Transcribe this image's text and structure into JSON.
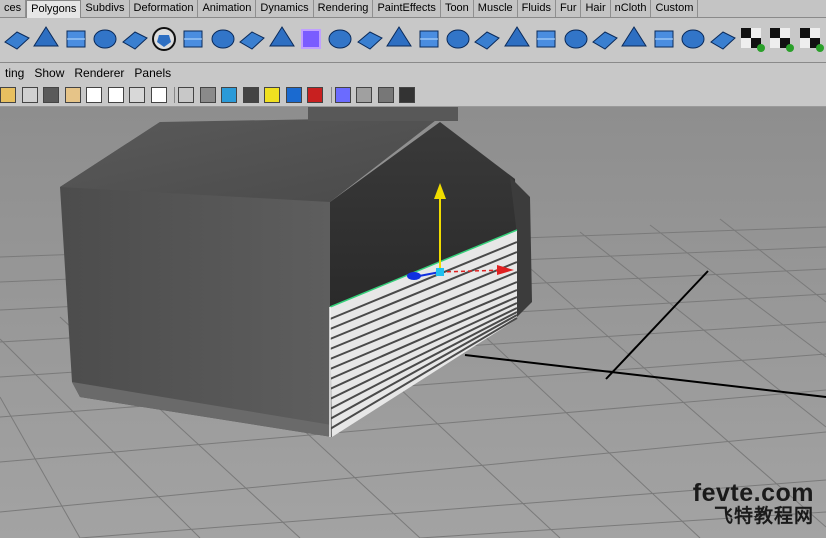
{
  "shelf_tabs": [
    {
      "label": "ces",
      "active": false
    },
    {
      "label": "Polygons",
      "active": true
    },
    {
      "label": "Subdivs",
      "active": false
    },
    {
      "label": "Deformation",
      "active": false
    },
    {
      "label": "Animation",
      "active": false
    },
    {
      "label": "Dynamics",
      "active": false
    },
    {
      "label": "Rendering",
      "active": false
    },
    {
      "label": "PaintEffects",
      "active": false
    },
    {
      "label": "Toon",
      "active": false
    },
    {
      "label": "Muscle",
      "active": false
    },
    {
      "label": "Fluids",
      "active": false
    },
    {
      "label": "Fur",
      "active": false
    },
    {
      "label": "Hair",
      "active": false
    },
    {
      "label": "nCloth",
      "active": false
    },
    {
      "label": "Custom",
      "active": false
    }
  ],
  "shelf_icons": [
    "poly-cylinder-partial-icon",
    "poly-plane-icon",
    "poly-torus-icon",
    "poly-pyramid-icon",
    "poly-cylinder-icon",
    "poly-soccerball-icon",
    "combine-icon",
    "separate-icon",
    "mirror-geometry-icon",
    "boolean-union-icon",
    "smooth-proxy-icon",
    "extrude-face-icon",
    "split-polygon-icon",
    "bevel-icon",
    "append-polygon-icon",
    "fill-hole-icon",
    "merge-vertices-icon",
    "slide-edge-icon",
    "insert-edge-loop-icon",
    "wedge-icon",
    "poke-face-icon",
    "triangulate-icon",
    "quadrangulate-icon",
    "move-uvs-icon",
    "planar-mapping-icon",
    "checker-uv-icon",
    "uv-snapshot-icon",
    "uv-texture-editor-icon"
  ],
  "menu": [
    "ting",
    "Show",
    "Renderer",
    "Panels"
  ],
  "toolbar_icons": [
    "shading-grid-icon",
    "wireframe-icon",
    "smooth-shade-icon",
    "flat-shade-icon",
    "texture-toggle-icon",
    "light-toggle-icon",
    "resolution-gate-icon",
    "text-overlay-icon",
    "camera-icon",
    "xray-cube-icon",
    "isolate-select-icon",
    "shadow-cube-icon",
    "use-lights-icon",
    "blue-cube-icon",
    "red-cube-icon",
    "frame-selection-icon",
    "wire-on-shaded-icon",
    "xray-joints-icon",
    "hud-icon"
  ],
  "watermark": {
    "site": "fevte.com",
    "cn": "飞特教程网"
  }
}
